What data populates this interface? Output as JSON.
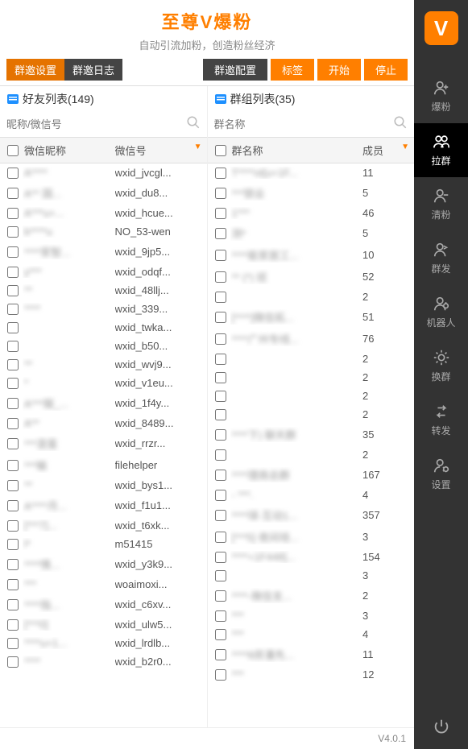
{
  "header": {
    "title": "至尊V爆粉",
    "subtitle": "自动引流加粉，创造粉丝经济"
  },
  "tabs": {
    "settings": "群邀设置",
    "log": "群邀日志"
  },
  "buttons": {
    "config": "群邀配置",
    "tag": "标签",
    "start": "开始",
    "stop": "停止"
  },
  "friends": {
    "title": "好友列表(149)",
    "search_placeholder": "昵称/微信号",
    "col1": "微信昵称",
    "col2": "微信号",
    "rows": [
      {
        "nick": "A****",
        "wxid": "wxid_jvcgl..."
      },
      {
        "nick": "A** 国...",
        "wxid": "wxid_du8..."
      },
      {
        "nick": "A***u+...",
        "wxid": "wxid_hcue..."
      },
      {
        "nick": "b****u",
        "wxid": "NO_53-wen"
      },
      {
        "nick": "****家智...",
        "wxid": "wxid_9jp5..."
      },
      {
        "nick": "y***",
        "wxid": "wxid_odqf..."
      },
      {
        "nick": "**",
        "wxid": "wxid_48llj..."
      },
      {
        "nick": "****",
        "wxid": "wxid_339..."
      },
      {
        "nick": "",
        "wxid": "wxid_twka..."
      },
      {
        "nick": "",
        "wxid": "wxid_b50..."
      },
      {
        "nick": "**",
        "wxid": "wxid_wvj9..."
      },
      {
        "nick": "*",
        "wxid": "wxid_v1eu..."
      },
      {
        "nick": "A***服_...",
        "wxid": "wxid_1f4y..."
      },
      {
        "nick": "A**",
        "wxid": "wxid_8489..."
      },
      {
        "nick": "***混蛋",
        "wxid": "wxid_rrzr..."
      },
      {
        "nick": "***输",
        "wxid": "filehelper"
      },
      {
        "nick": "**",
        "wxid": "wxid_bys1..."
      },
      {
        "nick": "A****月...",
        "wxid": "wxid_f1u1..."
      },
      {
        "nick": "[***7]...",
        "wxid": "wxid_t6xk..."
      },
      {
        "nick": "l*",
        "wxid": "m51415"
      },
      {
        "nick": "****情...",
        "wxid": "wxid_y3k9..."
      },
      {
        "nick": "***",
        "wxid": "woaimoxi..."
      },
      {
        "nick": "****指...",
        "wxid": "wxid_c6xv..."
      },
      {
        "nick": "[***0]",
        "wxid": "wxid_ulw5..."
      },
      {
        "nick": "****u+1...",
        "wxid": "wxid_lrdlb..."
      },
      {
        "nick": "****",
        "wxid": "wxid_b2r0..."
      }
    ]
  },
  "groups": {
    "title": "群组列表(35)",
    "search_placeholder": "群名称",
    "col1": "群名称",
    "col2": "成员",
    "rows": [
      {
        "name": "T****ot[u+1F...",
        "count": "11"
      },
      {
        "name": "***锁业",
        "count": "5"
      },
      {
        "name": "1***",
        "count": "46"
      },
      {
        "name": "测*",
        "count": "5"
      },
      {
        "name": "****能家居工...",
        "count": "10"
      },
      {
        "name": "** (*) 班",
        "count": "52"
      },
      {
        "name": "",
        "count": "2"
      },
      {
        "name": "[****]微信拓...",
        "count": "51"
      },
      {
        "name": "****广州专线...",
        "count": "76"
      },
      {
        "name": "",
        "count": "2"
      },
      {
        "name": "",
        "count": "2"
      },
      {
        "name": "",
        "count": "2"
      },
      {
        "name": "",
        "count": "2"
      },
      {
        "name": "****下) 聊天群",
        "count": "35"
      },
      {
        "name": "",
        "count": "2"
      },
      {
        "name": "****理商总群",
        "count": "167"
      },
      {
        "name": "- ***.",
        "count": "4"
      },
      {
        "name": "****球-互动1...",
        "count": "357"
      },
      {
        "name": "[***5] 夜间培...",
        "count": "3"
      },
      {
        "name": "****+1F448]...",
        "count": "154"
      },
      {
        "name": "",
        "count": "3"
      },
      {
        "name": "****-微信支...",
        "count": "2"
      },
      {
        "name": "***",
        "count": "3"
      },
      {
        "name": "***",
        "count": "4"
      },
      {
        "name": "****8房潘先...",
        "count": "11"
      },
      {
        "name": "***",
        "count": "12"
      }
    ]
  },
  "footer": {
    "version": "V4.0.1"
  },
  "sidebar": {
    "items": [
      {
        "label": "爆粉"
      },
      {
        "label": "拉群"
      },
      {
        "label": "清粉"
      },
      {
        "label": "群发"
      },
      {
        "label": "机器人"
      },
      {
        "label": "换群"
      },
      {
        "label": "转发"
      },
      {
        "label": "设置"
      }
    ]
  }
}
